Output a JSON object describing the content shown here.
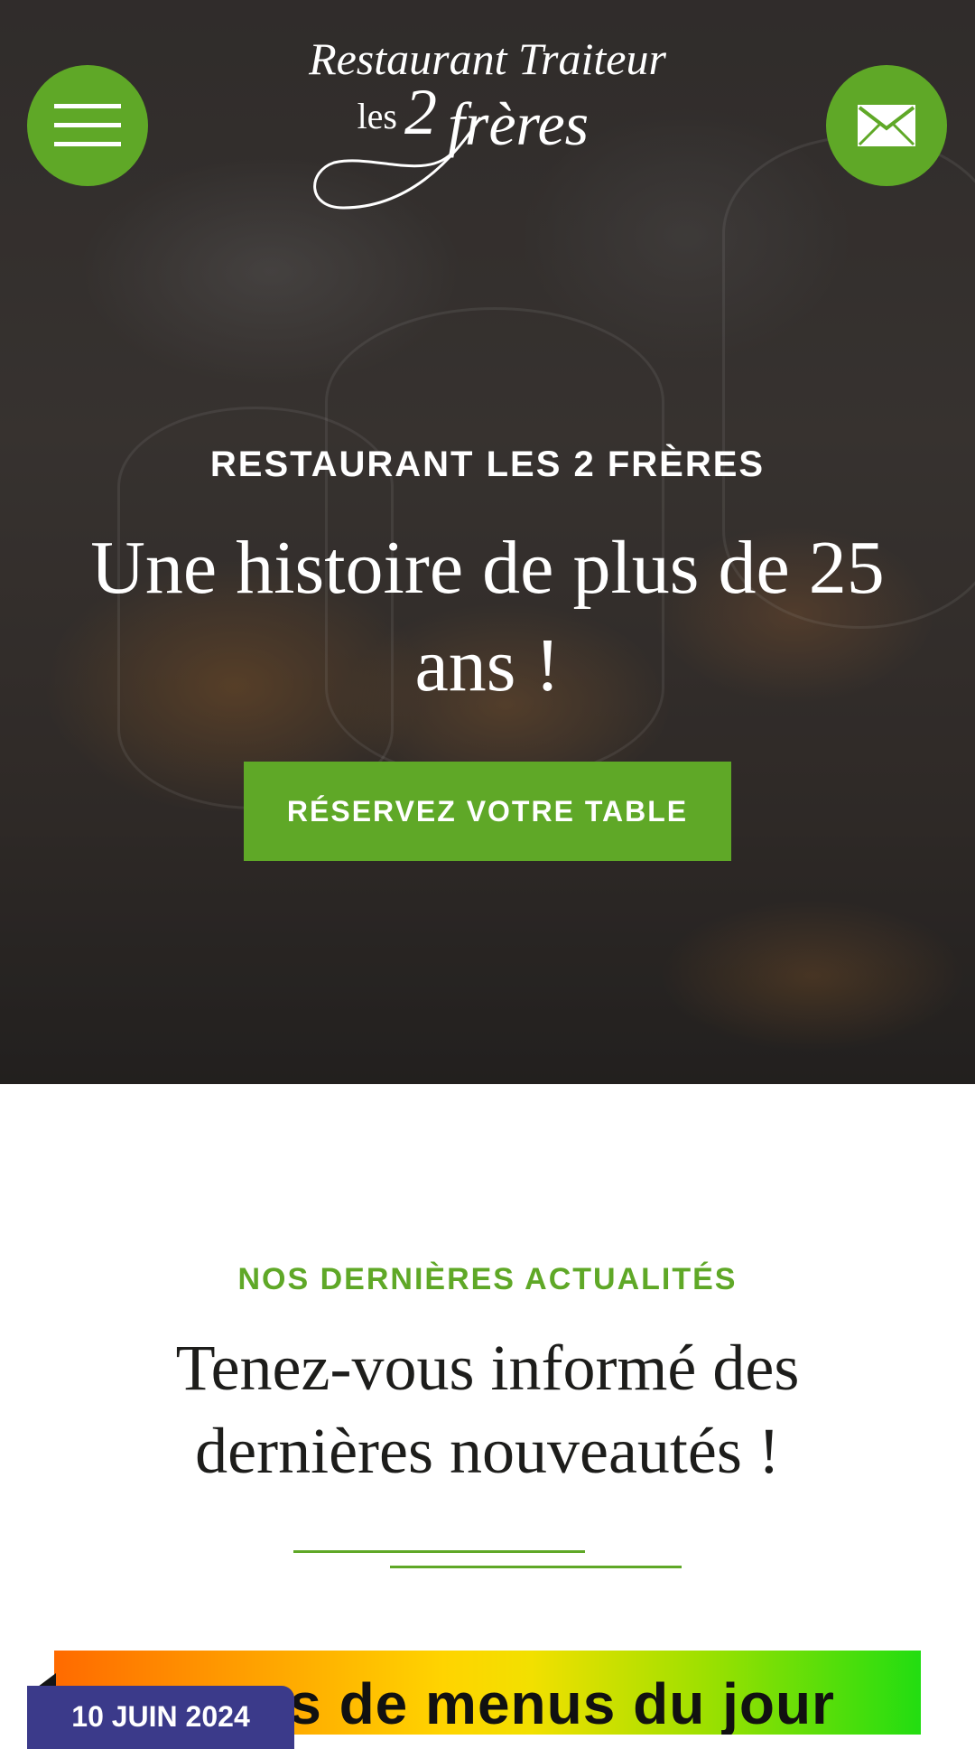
{
  "header": {
    "logo_line1": "Restaurant Traiteur",
    "logo_line2_prefix": "les",
    "logo_number": "2",
    "logo_line2_suffix": "frères",
    "menu_icon": "hamburger-menu-icon",
    "mail_icon": "envelope-icon"
  },
  "hero": {
    "kicker": "RESTAURANT LES 2 FRÈRES",
    "title": "Une histoire de plus de 25 ans !",
    "cta_label": "RÉSERVEZ VOTRE TABLE"
  },
  "news": {
    "kicker": "NOS DERNIÈRES ACTUALITÉS",
    "title": "Tenez-vous informé des dernières nouveautés !",
    "card": {
      "date": "10 JUIN 2024",
      "image_text": "ons de menus du jour"
    }
  },
  "colors": {
    "accent_green": "#5fa827",
    "badge_purple": "#3b3a8a",
    "heading_dark": "#1d1d1b"
  }
}
